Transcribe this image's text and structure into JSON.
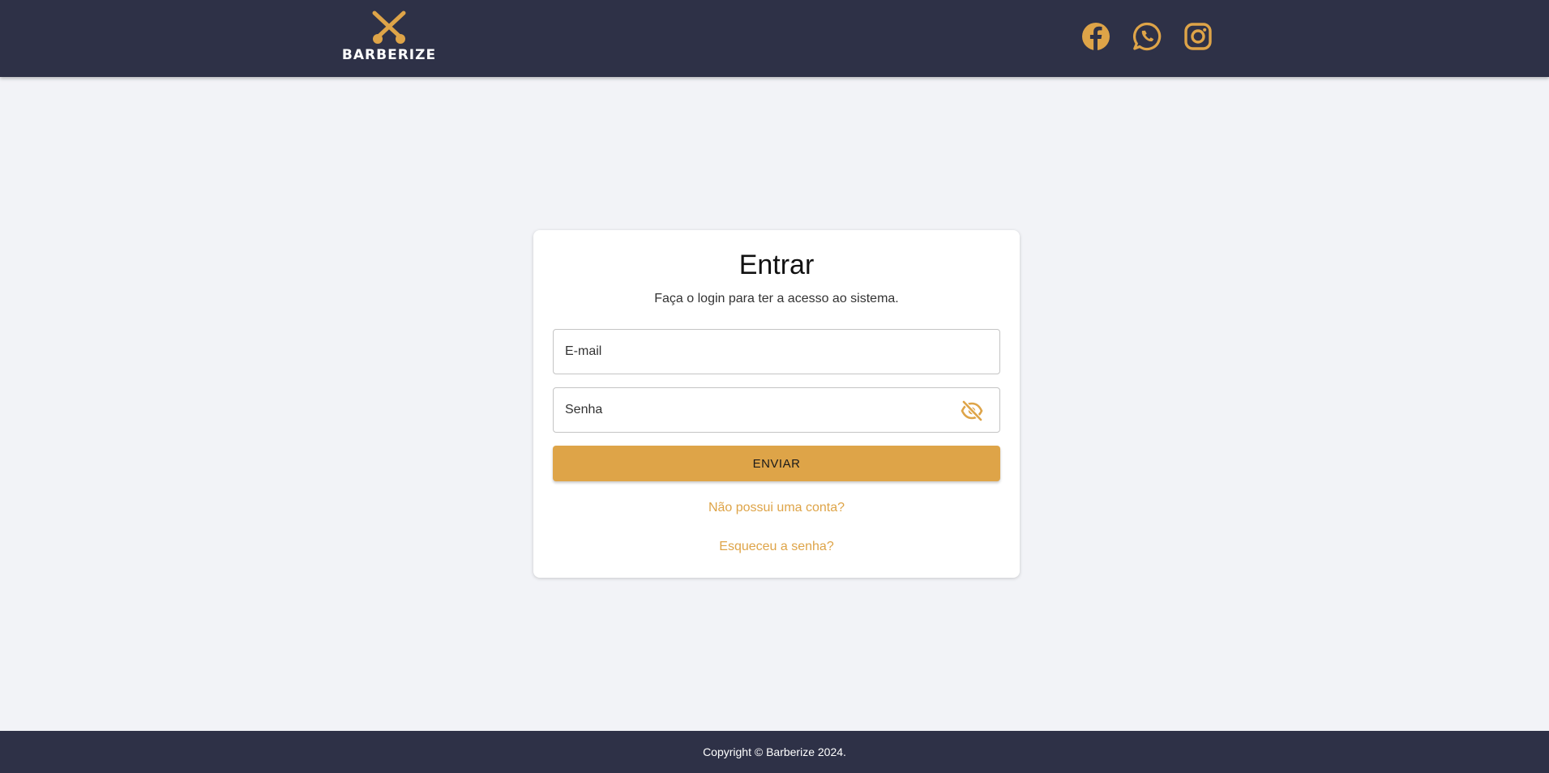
{
  "header": {
    "logo_text": "BARBERIZE",
    "social": [
      {
        "name": "facebook-icon"
      },
      {
        "name": "whatsapp-icon"
      },
      {
        "name": "instagram-icon"
      }
    ]
  },
  "login": {
    "title": "Entrar",
    "subtitle": "Faça o login para ter a acesso ao sistema.",
    "email_placeholder": "E-mail",
    "email_value": "",
    "password_placeholder": "Senha",
    "password_value": "",
    "password_toggle_icon": "eye-off-icon",
    "submit_label": "ENVIAR",
    "signup_link": "Não possui uma conta?",
    "forgot_link": "Esqueceu a senha?"
  },
  "footer": {
    "copyright": "Copyright © Barberize 2024."
  },
  "colors": {
    "header_bg": "#2e3147",
    "accent": "#dea448",
    "page_bg": "#f2f3f7"
  }
}
